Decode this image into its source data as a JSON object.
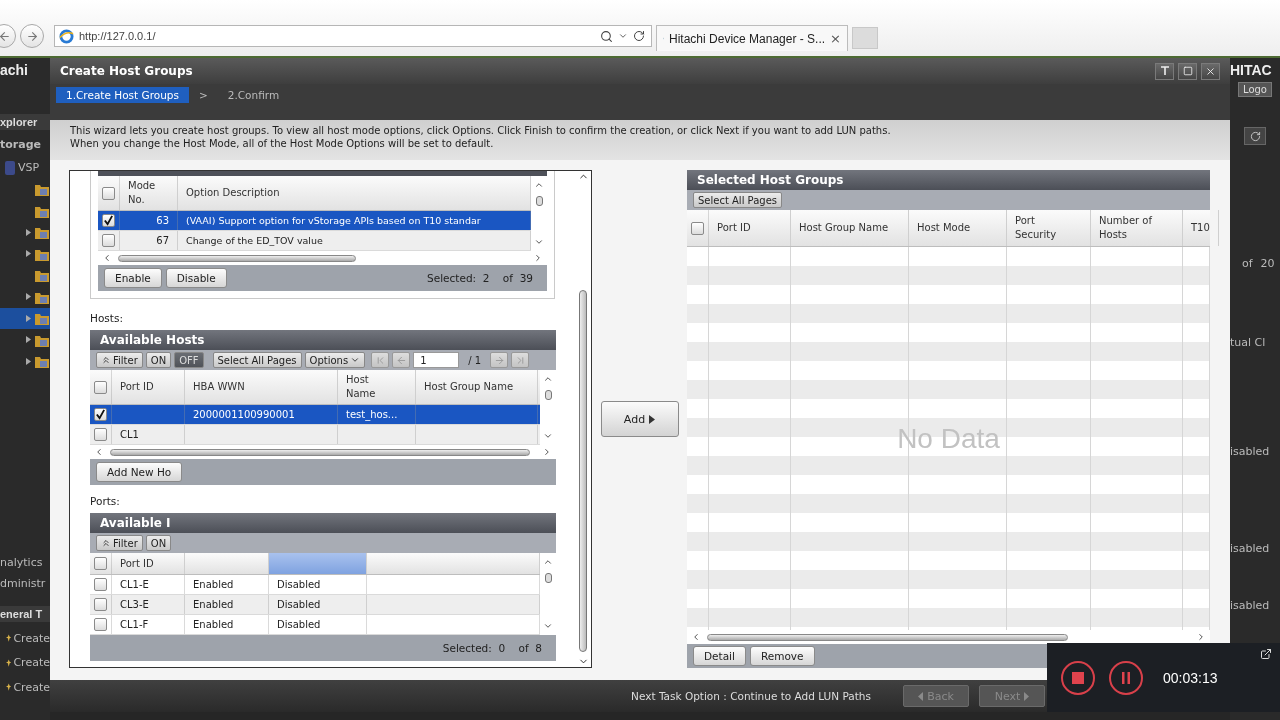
{
  "browser": {
    "url": "http://127.0.0.1/",
    "tab_title": "Hitachi Device Manager - S...",
    "tab_close": "×"
  },
  "background_app": {
    "brand": "achi",
    "explorer": "xplorer",
    "storage": "torage",
    "tree_root": "VSP",
    "tree_items": [
      {
        "expandable": false,
        "selected": false
      },
      {
        "expandable": false,
        "selected": false
      },
      {
        "expandable": true,
        "selected": false
      },
      {
        "expandable": true,
        "selected": false
      },
      {
        "expandable": false,
        "selected": false
      },
      {
        "expandable": true,
        "selected": false
      },
      {
        "expandable": true,
        "selected": true
      },
      {
        "expandable": true,
        "selected": false
      },
      {
        "expandable": true,
        "selected": false
      }
    ],
    "nav": [
      "nalytics",
      "dministr"
    ],
    "tasks_title": "eneral T",
    "tasks": [
      "Create",
      "Create",
      "Create"
    ],
    "brand_right": "HITAC",
    "logout": "Logo",
    "page_of": "of",
    "page_total": "20",
    "fragment": "tual Cl",
    "statuses": [
      "isabled",
      "isabled",
      "isabled"
    ]
  },
  "dialog": {
    "title": "Create Host Groups",
    "steps": [
      {
        "label": "1.Create Host Groups",
        "selected": true
      },
      {
        "label": "2.Confirm",
        "selected": false
      }
    ],
    "step_separator": ">",
    "description": [
      "This wizard lets you create host groups. To view all host mode options, click Options. Click Finish to confirm the creation, or click Next if you want to add LUN paths.",
      "When you change the Host Mode, all of the Host Mode Options will be set to default."
    ],
    "host_mode_options": {
      "select_all_checked": false,
      "columns": [
        "Mode No.",
        "Option Description"
      ],
      "rows": [
        {
          "mode_no": "63",
          "description": "(VAAI) Support option for vStorage APIs based on T10 standar",
          "checked": true,
          "selected": true
        },
        {
          "mode_no": "67",
          "description": "Change of the ED_TOV value",
          "checked": false,
          "selected": false
        }
      ],
      "buttons": [
        "Enable",
        "Disable"
      ],
      "selected_label": "Selected:",
      "selected_count": "2",
      "of_label": "of",
      "total": "39"
    },
    "hosts": {
      "label": "Hosts:",
      "title": "Available Hosts",
      "filter": "Filter",
      "toggle": [
        {
          "label": "ON",
          "selected": false
        },
        {
          "label": "OFF",
          "selected": true
        }
      ],
      "select_all": "Select All Pages",
      "options": "Options",
      "page": "1",
      "page_total": "/ 1",
      "select_all_checked": false,
      "columns": [
        "Port ID",
        "HBA WWN",
        "Host Name",
        "Host Group Name"
      ],
      "rows": [
        {
          "hba_wwn": "2000001100990001",
          "host_name": "test_hos...",
          "checked": true,
          "selected": true
        },
        {
          "port_id": "CL1",
          "checked": false,
          "selected": false
        }
      ],
      "add_button": "Add New Ho"
    },
    "ports": {
      "label": "Ports:",
      "title": "Available I",
      "filter": "Filter",
      "toggle": [
        {
          "label": "ON",
          "selected": false
        }
      ],
      "select_all_checked": false,
      "columns": [
        "Port ID"
      ],
      "rows": [
        {
          "port_id": "CL1-E",
          "column_2": "Enabled",
          "column_3": "Disabled",
          "checked": false,
          "selected": false
        },
        {
          "port_id": "CL3-E",
          "column_2": "Enabled",
          "column_3": "Disabled",
          "checked": false,
          "selected": false
        },
        {
          "port_id": "CL1-F",
          "column_2": "Enabled",
          "column_3": "Disabled",
          "checked": false,
          "selected": false
        }
      ],
      "selected_label": "Selected:",
      "selected_count": "0",
      "of_label": "of",
      "total": "8"
    },
    "add_button": "Add",
    "selected_host_groups": {
      "title": "Selected Host Groups",
      "select_all": "Select All Pages",
      "select_all_checked": false,
      "columns": [
        "Port ID",
        "Host Group Name",
        "Host Mode",
        "Port Security",
        "Number of Hosts",
        "T10"
      ],
      "empty_text": "No Data",
      "buttons": [
        "Detail",
        "Remove"
      ]
    },
    "footer": {
      "next_task_option": "Next Task Option : Continue to Add LUN Paths",
      "buttons": [
        {
          "label": "Back",
          "kind": "back",
          "disabled": true
        },
        {
          "label": "Next",
          "kind": "next",
          "disabled": true
        }
      ]
    }
  },
  "recorder": {
    "time": "00:03:13"
  }
}
